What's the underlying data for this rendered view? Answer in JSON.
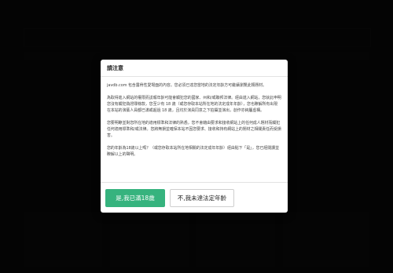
{
  "modal": {
    "title": "請注意",
    "paragraphs": [
      "javdb.com 包含露骨性愛場面的內容。您必須已達您當地的法定年齡方可繼續瀏覽此類題材。",
      "為取得進入網站的權限而謊報年齡可能會觸犯您的國家、州和/或聯邦法律。經由進入網站，您就此申明您沒有觸犯偽證罪條款，您至少有 18 歲（或您存取本站所在地的法定成年年齡），您也瞭解所有出現在本站的演藝人員都已滿或超過 18 歲，且均於演員同意之下拍攝並演出，創作亦純屬虛構。",
      "您要明瞭並對您所在地的適用標準和法律的熟悉，您不會藉由要求和接收網站上的任何成人題材而觸犯任何適用標準和/或法律。您將無損並確保本站不因您要求、接收和持有網站上的題材之相關責任而受損害。",
      "您的年齡為18歲以上嗎？（或您存取本站所在地相關的法定成年年齡）經由點下「是」，您已經閱讀並瞭解以上的聲明。"
    ],
    "yes_label": "是,我已滿18歲",
    "no_label": "不,我未達法定年齡"
  }
}
